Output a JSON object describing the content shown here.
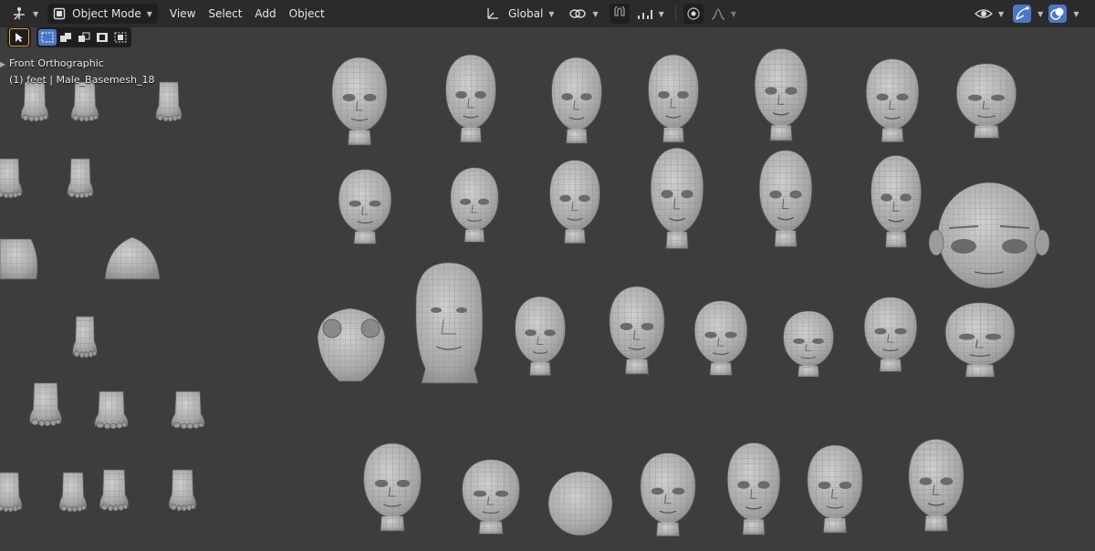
{
  "header": {
    "mode_label": "Object Mode",
    "menu": [
      "View",
      "Select",
      "Add",
      "Object"
    ],
    "transform_orientation": "Global"
  },
  "viewport": {
    "view_name": "Front Orthographic",
    "collection_info": "(1) feet | Male_Basemesh_18"
  },
  "colors": {
    "background": "#3d3d3d",
    "header": "#2b2b2b",
    "accent": "#4a77c8",
    "mesh": "#b4b4b4"
  }
}
